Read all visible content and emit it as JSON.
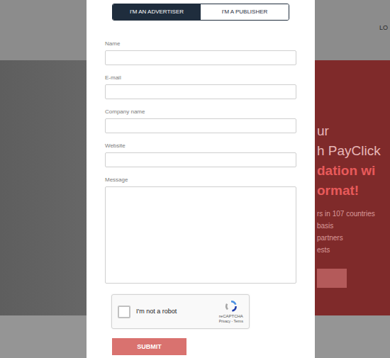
{
  "background": {
    "header": {
      "nav_item": "LO"
    },
    "hero": {
      "headline": [
        {
          "text": "ur",
          "strong": false
        },
        {
          "text": "h PayClick",
          "strong": false
        },
        {
          "text": "dation wi",
          "strong": true
        },
        {
          "text": "ormat!",
          "strong": true
        }
      ],
      "details": [
        "rs in 107 countries",
        "basis",
        "partners",
        "ests"
      ]
    }
  },
  "modal": {
    "tabs": [
      {
        "label": "I'M AN ADVERTISER",
        "selected": true
      },
      {
        "label": "I'M A PUBLISHER",
        "selected": false
      }
    ],
    "fields": [
      {
        "label": "Name",
        "kind": "input",
        "value": ""
      },
      {
        "label": "E-mail",
        "kind": "input",
        "value": ""
      },
      {
        "label": "Company name",
        "kind": "input",
        "value": ""
      },
      {
        "label": "Website",
        "kind": "input",
        "value": ""
      },
      {
        "label": "Message",
        "kind": "textarea",
        "value": ""
      }
    ],
    "captcha": {
      "label": "I'm not a robot",
      "checked": false,
      "brand": "reCAPTCHA",
      "links": "Privacy - Terms"
    },
    "submit": "SUBMIT"
  }
}
